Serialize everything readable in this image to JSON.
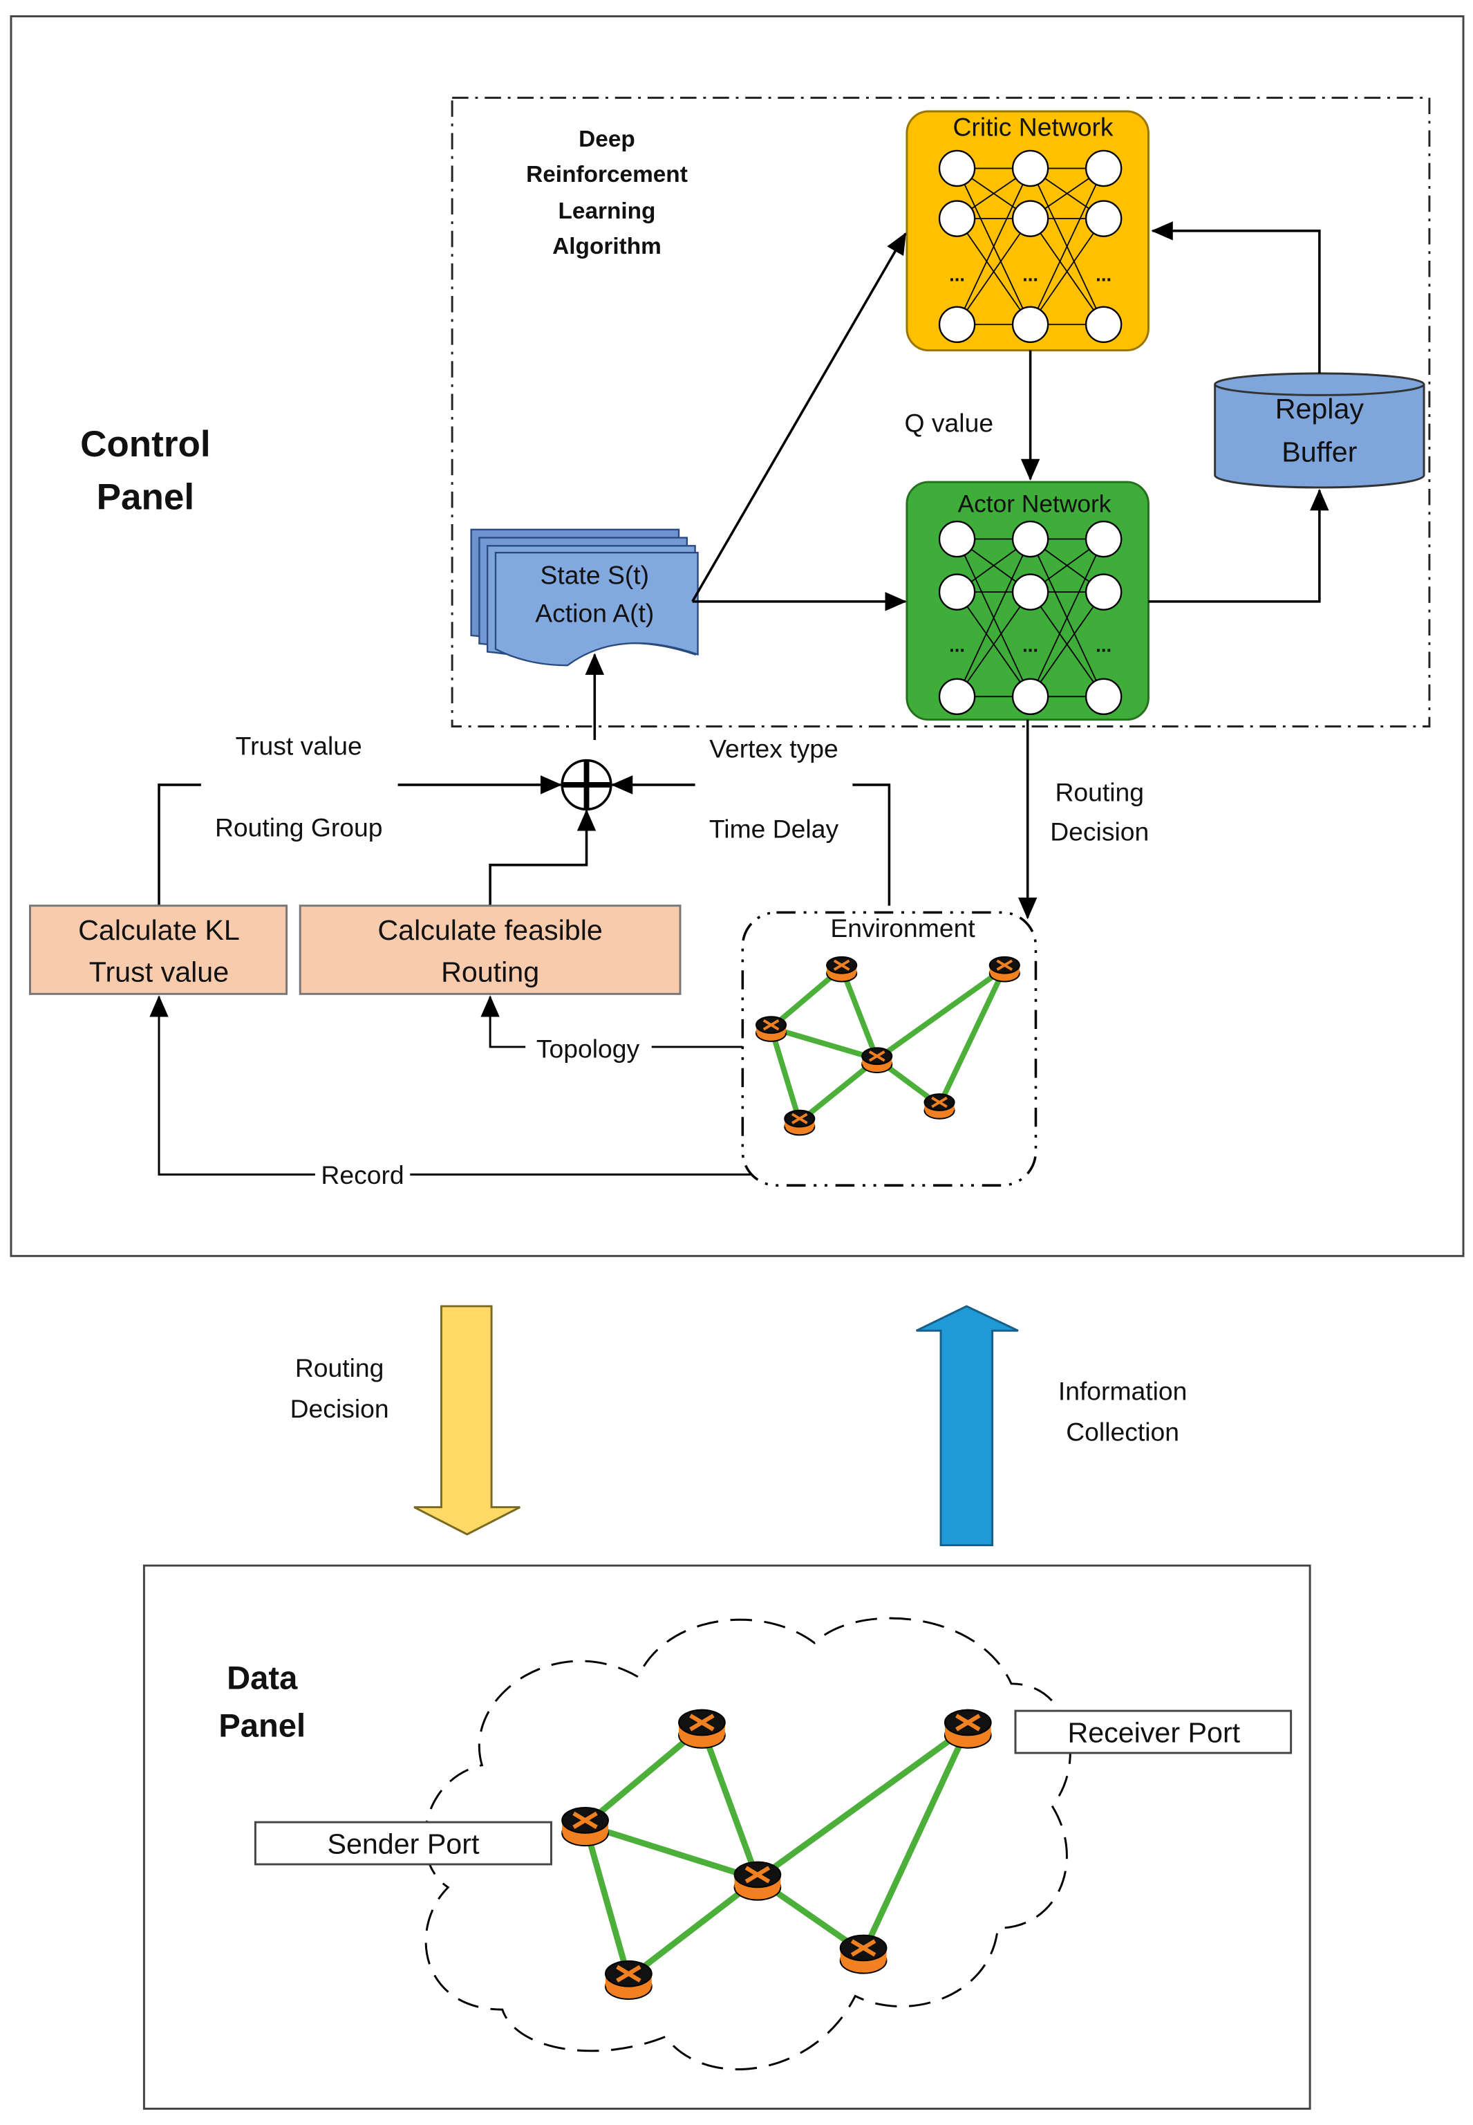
{
  "control_panel": {
    "title_lines": [
      "Control",
      "Panel"
    ],
    "drl_label_lines": [
      "Deep",
      "Reinforcement",
      "Learning",
      "Algorithm"
    ],
    "critic_network": "Critic Network",
    "actor_network": "Actor Network",
    "nn_ellipsis": "...",
    "q_value": "Q value",
    "replay_buffer_lines": [
      "Replay",
      "Buffer"
    ],
    "state_action_lines": [
      "State S(t)",
      "Action A(t)"
    ],
    "trust_value": "Trust value",
    "routing_group": "Routing Group",
    "vertex_type": "Vertex type",
    "time_delay": "Time Delay",
    "routing_decision_lines": [
      "Routing",
      "Decision"
    ],
    "calc_kl_lines": [
      "Calculate KL",
      "Trust value"
    ],
    "calc_feasible_lines": [
      "Calculate feasible",
      "Routing"
    ],
    "environment": "Environment",
    "topology": "Topology",
    "record": "Record"
  },
  "between": {
    "routing_decision_lines": [
      "Routing",
      "Decision"
    ],
    "information_collection_lines": [
      "Information",
      "Collection"
    ]
  },
  "data_panel": {
    "title_lines": [
      "Data",
      "Panel"
    ],
    "sender_port": "Sender Port",
    "receiver_port": "Receiver Port"
  },
  "colors": {
    "critic": "#FFC000",
    "actor": "#3FAD3A",
    "replay_buffer": "#7EA6DC",
    "calc_box": "#F8CBAD",
    "link": "#4CAF3A",
    "router": "#F08020",
    "down_arrow": "#FFD966",
    "up_arrow": "#1F9AD6"
  }
}
